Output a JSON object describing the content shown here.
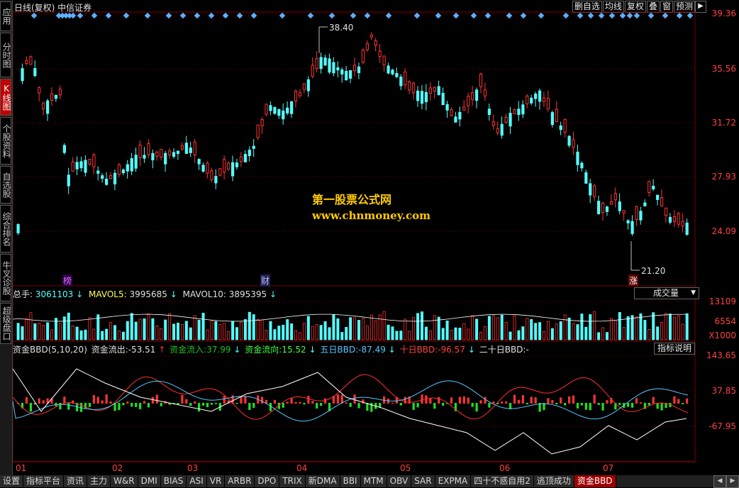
{
  "left_tabs": [
    {
      "label": "应用",
      "active": false
    },
    {
      "label": "分时图",
      "active": false
    },
    {
      "label": "K线图",
      "active": true
    },
    {
      "label": "个股资料",
      "active": false
    },
    {
      "label": "自选股",
      "active": false
    },
    {
      "label": "综合排名",
      "active": false
    },
    {
      "label": "牛叉诊股",
      "active": false
    },
    {
      "label": "超级盘口",
      "active": false
    }
  ],
  "header": {
    "title": "日线(复权)  中信证券",
    "buttons": [
      "删自选",
      "均线",
      "复权",
      "叠",
      "窗",
      "预测"
    ]
  },
  "price_axis": {
    "labels": [
      "39.36",
      "35.56",
      "31.72",
      "27.93",
      "24.09"
    ]
  },
  "price_annotations": {
    "high": "38.40",
    "low": "21.20"
  },
  "event_markers": {
    "m1": "榜",
    "m2": "财",
    "m3": "涨"
  },
  "volume_panel": {
    "label_total": "总手:",
    "total_value": "3061103",
    "mavol5_label": "MAVOL5:",
    "mavol5_value": "3995685",
    "mavol10_label": "MAVOL10:",
    "mavol10_value": "3895395",
    "dropdown": "成交量",
    "axis": [
      "13109",
      "6554",
      "X1000"
    ]
  },
  "bbd_panel": {
    "name": "资金BBD(5,10,20)",
    "out_label": "资金流出:",
    "out_value": "-53.51",
    "in_label": "资金流入:",
    "in_value": "37.99",
    "dir_label": "资金流向:",
    "dir_value": "15.52",
    "d5_label": "五日BBD:",
    "d5_value": "-87.49",
    "d10_label": "十日BBD:",
    "d10_value": "-96.57",
    "d20_label": "二十日BBD:",
    "d20_value": "-",
    "help_button": "指标说明",
    "axis": [
      "143.65",
      "37.85",
      "-67.95"
    ]
  },
  "x_axis": {
    "labels": [
      "01",
      "02",
      "03",
      "04",
      "05",
      "06",
      "07"
    ]
  },
  "watermark": {
    "line1": "第一股票公式网",
    "line2": "www.chnmoney.com"
  },
  "bottom_tabs": [
    "设置",
    "指标平台",
    "资讯",
    "主力",
    "W&R",
    "DMI",
    "BIAS",
    "ASI",
    "VR",
    "ARBR",
    "DPO",
    "TRIX",
    "新DMA",
    "BBI",
    "MTM",
    "OBV",
    "SAR",
    "EXPMA",
    "四十不惑自用2",
    "逃顶成功",
    "资金BBD"
  ],
  "bottom_active": "资金BBD",
  "colors": {
    "up": "#ff3333",
    "down": "#54ffff",
    "grid": "#7a0000",
    "axis_text": "#ff4040"
  }
}
